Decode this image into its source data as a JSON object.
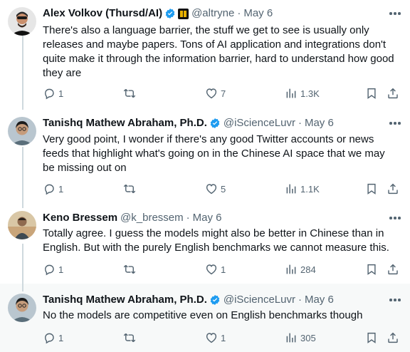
{
  "tweets": [
    {
      "author": "Alex Volkov (Thursd/AI)",
      "handle": "@altryne",
      "date": "May 6",
      "text": "There's also a language barrier, the stuff we get to see is usually only releases and maybe papers. Tons of AI application and integrations don't quite make it through the information barrier, hard to understand how good they are",
      "replies": "1",
      "retweets": "",
      "likes": "7",
      "views": "1.3K",
      "verified": true,
      "org_badge": true
    },
    {
      "author": "Tanishq Mathew Abraham, Ph.D.",
      "handle": "@iScienceLuvr",
      "date": "May 6",
      "text": "Very good point, I wonder if there's any good Twitter accounts or news feeds that highlight what's going on in the Chinese AI space that we may be missing out on",
      "replies": "1",
      "retweets": "",
      "likes": "5",
      "views": "1.1K",
      "verified": true,
      "org_badge": false
    },
    {
      "author": "Keno Bressem",
      "handle": "@k_bressem",
      "date": "May 6",
      "text": "Totally agree. I guess the models might also be better in Chinese than in English. But with the purely English benchmarks we cannot measure this.",
      "replies": "1",
      "retweets": "",
      "likes": "1",
      "views": "284",
      "verified": false,
      "org_badge": false
    },
    {
      "author": "Tanishq Mathew Abraham, Ph.D.",
      "handle": "@iScienceLuvr",
      "date": "May 6",
      "text": "No the models are competitive even on English benchmarks though",
      "replies": "1",
      "retweets": "",
      "likes": "1",
      "views": "305",
      "verified": true,
      "org_badge": false
    }
  ],
  "separator": "·",
  "colors": {
    "text": "#0f1419",
    "secondary": "#536471",
    "verified": "#1d9bf0",
    "thread_line": "#cfd9de",
    "highlight_bg": "#f7f9f9"
  },
  "icons": [
    "reply-icon",
    "retweet-icon",
    "like-icon",
    "views-icon",
    "bookmark-icon",
    "share-icon",
    "more-icon",
    "verified-icon"
  ]
}
